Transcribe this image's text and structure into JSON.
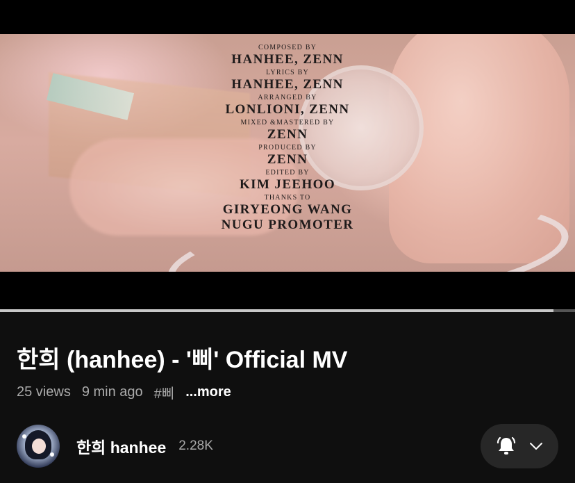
{
  "video": {
    "credits": [
      {
        "role": "COMPOSED BY",
        "name": "HANHEE, ZENN"
      },
      {
        "role": "LYRICS BY",
        "name": "HANHEE, ZENN"
      },
      {
        "role": "ARRANGED BY",
        "name": "LONLIONI, ZENN"
      },
      {
        "role": "MIXED &MASTERED BY",
        "name": "ZENN"
      },
      {
        "role": "PRODUCED BY",
        "name": "ZENN"
      },
      {
        "role": "EDITED BY",
        "name": "KIM JEEHOO"
      },
      {
        "role": "THANKS TO",
        "name": "GIRYEONG WANG"
      },
      {
        "role": "",
        "name": "NUGU PROMOTER"
      }
    ],
    "progress_fraction": 0.963
  },
  "title": "한희 (hanhee) - '삐' Official MV",
  "meta": {
    "views": "25 views",
    "time_ago": "9 min ago",
    "hashtag": "#삐",
    "more": "...more"
  },
  "channel": {
    "name": "한희 hanhee",
    "subscribers": "2.28K",
    "avatar_icon": "channel-avatar"
  },
  "subscribe": {
    "bell_icon": "bell-icon",
    "chevron_icon": "chevron-down-icon"
  },
  "colors": {
    "background": "#0f0f0f",
    "secondary_text": "#aaaaaa",
    "button_bg": "#272727"
  }
}
